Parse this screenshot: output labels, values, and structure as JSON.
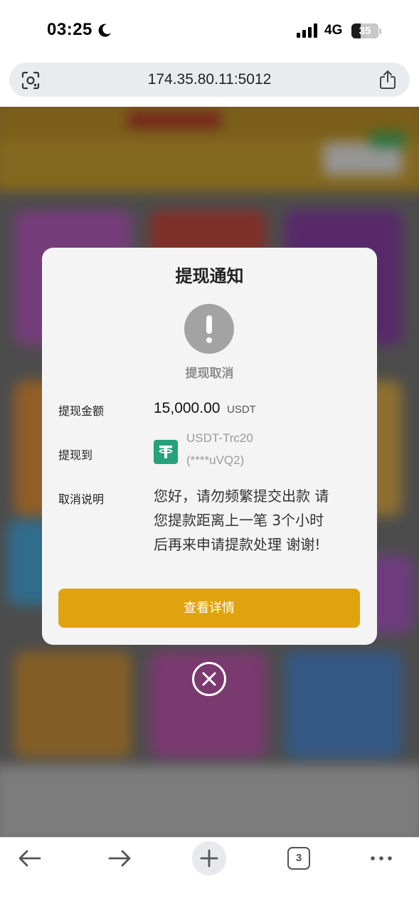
{
  "status_bar": {
    "time": "03:25",
    "network": "4G",
    "battery": "35",
    "battery_fraction": 0.35
  },
  "browser": {
    "url": "174.35.80.11:5012",
    "tab_count": "3"
  },
  "modal": {
    "title": "提现通知",
    "status_caption": "提现取消",
    "amount_label": "提现金额",
    "amount_value": "15,000.00",
    "amount_unit": "USDT",
    "destination_label": "提现到",
    "account_name": "USDT-Trc20",
    "account_number": "(****uVQ2)",
    "note_label": "取消说明",
    "note_lines": [
      "您好，请勿频繁提交出款 请",
      "您提款距离上一笔 3个小时",
      "后再来申请提款处理 谢谢!"
    ],
    "details_button": "查看详情"
  },
  "colors": {
    "accent": "#e0a30e",
    "usdt_green": "#26a17b",
    "alert_gray": "#a3a3a3"
  },
  "icons": [
    "moon-icon",
    "signal-icon",
    "battery-icon",
    "lens-icon",
    "share-icon",
    "alert-icon",
    "usdt-icon",
    "close-icon",
    "back-arrow-icon",
    "forward-arrow-icon",
    "plus-icon",
    "tabs-icon",
    "more-icon"
  ]
}
